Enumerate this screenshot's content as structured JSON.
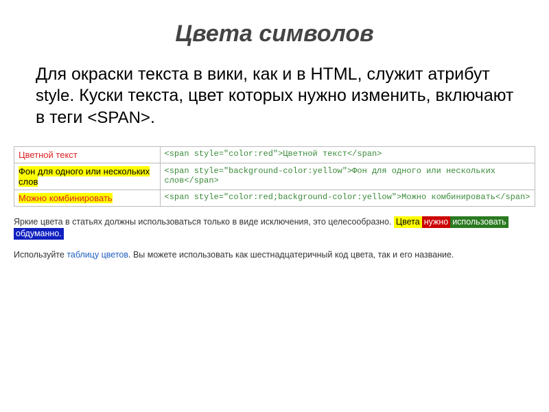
{
  "title": "Цвета символов",
  "body": {
    "line1_a": "Для окраски текста в вики, как и в ",
    "line1_b": "HTML",
    "line1_c": ", служит атрибут ",
    "line1_d": "style",
    "line1_e": ". Куски текста, цвет которых нужно изменить, включают в теги ",
    "line1_f": "<SPAN>",
    "line1_g": "."
  },
  "examples": [
    {
      "rendered": "Цветной текст",
      "rendered_style": "red",
      "code": "<span style=\"color:red\">Цветной текст</span>"
    },
    {
      "rendered": "Фон для одного или нескольких слов",
      "rendered_style": "yellow-bg",
      "code": "<span style=\"background-color:yellow\">Фон для одного или нескольких слов</span>"
    },
    {
      "rendered": "Можно комбинировать",
      "rendered_style": "red-yellow",
      "code": "<span style=\"color:red;background-color:yellow\">Можно комбинировать</span>"
    }
  ],
  "note1": {
    "prefix": "Яркие цвета в статьях должны использоваться только в виде исключения, это целесообразно. ",
    "badges": [
      {
        "text": "Цвета",
        "class": "b-yellow"
      },
      {
        "text": "нужно",
        "class": "b-red"
      },
      {
        "text": "использовать",
        "class": "b-green"
      },
      {
        "text": "обдуманно.",
        "class": "b-blue"
      }
    ]
  },
  "note2": {
    "a": "Используйте ",
    "link": "таблицу цветов",
    "b": ". Вы можете использовать как шестнадцатеричный код цвета, так и его название."
  }
}
